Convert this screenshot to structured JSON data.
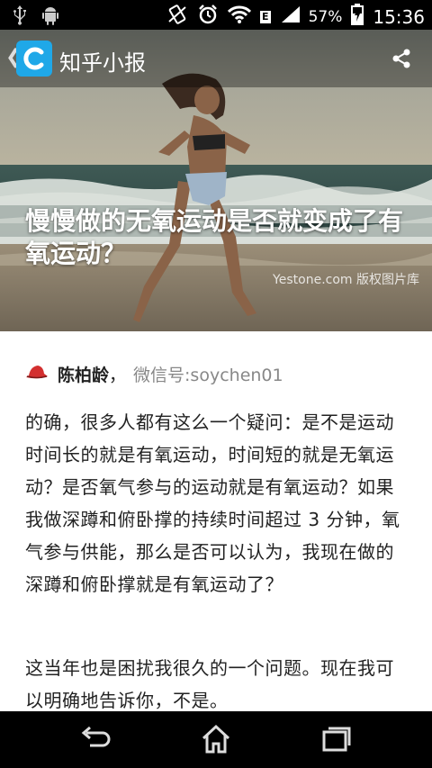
{
  "status_bar": {
    "battery_percent": "57%",
    "time": "15:36",
    "network_type": "E",
    "left_icons": [
      "usb-icon",
      "android-icon"
    ],
    "right_icons": [
      "vibrate-icon",
      "alarm-icon",
      "wifi-icon",
      "signal-icon",
      "battery-charging-icon"
    ]
  },
  "action_bar": {
    "title": "知乎小报",
    "logo_color": "#1fa8e8"
  },
  "hero": {
    "title": "慢慢做的无氧运动是否就变成了有氧运动？",
    "watermark": "Yestone.com 版权图片库"
  },
  "article": {
    "author_name": "陈柏龄",
    "author_separator": "，",
    "author_wechat": "微信号:soychen01",
    "paragraphs": [
      "的确，很多人都有这么一个疑问：是不是运动时间长的就是有氧运动，时间短的就是无氧运动？是否氧气参与的运动就是有氧运动？如果我做深蹲和俯卧撑的持续时间超过 3 分钟，氧气参与供能，那么是否可以认为，我现在做的深蹲和俯卧撑就是有氧运动了？",
      "这当年也是困扰我很久的一个问题。现在我可以明确地告诉你，不是。"
    ]
  },
  "nav_bar": {
    "buttons": [
      "back-icon",
      "home-icon",
      "recent-apps-icon"
    ]
  }
}
